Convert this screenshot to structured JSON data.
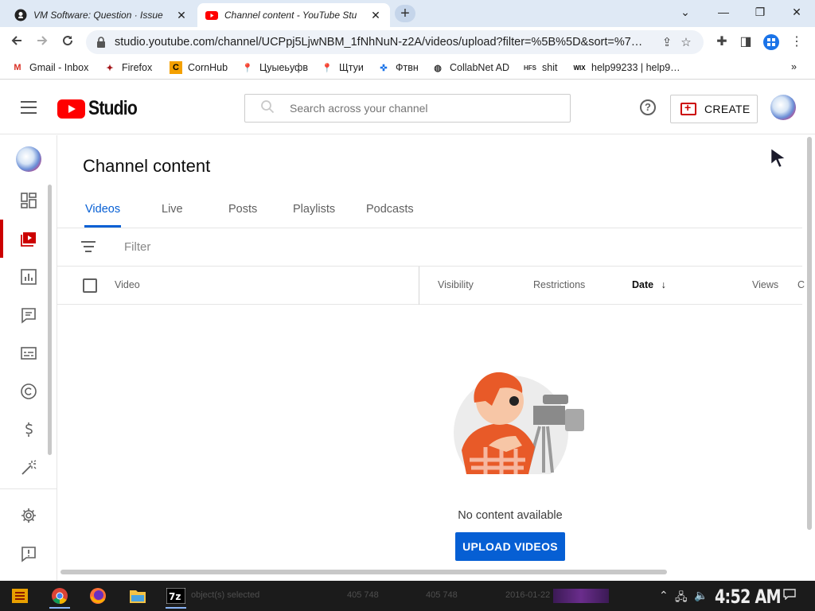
{
  "browser": {
    "tabs": [
      {
        "title": "VM Software: Question · Issue",
        "close": "✕"
      },
      {
        "title": "Channel content - YouTube Stu",
        "close": "✕"
      }
    ],
    "new_tab": "+",
    "window_controls": [
      "⌄",
      "—",
      "❐",
      "✕"
    ],
    "url": "studio.youtube.com/channel/UCPpj5LjwNBM_1fNhNuN-z2A/videos/upload?filter=%5B%5D&sort=%7…",
    "bookmarks": [
      "Gmail - Inbox",
      "Firefox",
      "CornHub",
      "Цуыеьуфв",
      "Щтуи",
      "Фтвн",
      "CollabNet AD",
      "shit",
      "help99233 | help9…"
    ],
    "bookmarks_overflow": "»"
  },
  "studio": {
    "logo_text": "Studio",
    "search_placeholder": "Search across your channel",
    "help_label": "?",
    "create_label": "CREATE"
  },
  "page": {
    "title": "Channel content",
    "tabs": [
      "Videos",
      "Live",
      "Posts",
      "Playlists",
      "Podcasts"
    ],
    "active_tab": "Videos",
    "filter_label": "Filter",
    "columns": {
      "video": "Video",
      "visibility": "Visibility",
      "restrictions": "Restrictions",
      "date": "Date",
      "date_sort": "↓",
      "views": "Views",
      "comments_partial": "C"
    },
    "empty_text": "No content available",
    "upload_button": "UPLOAD VIDEOS"
  },
  "taskbar": {
    "background_texts": [
      "object(s) selected",
      "405 748",
      "405 748",
      "2016-01-22 10:01"
    ],
    "clock": "4:52 AM",
    "tray": [
      "⌃",
      "🖧",
      "🔈"
    ]
  },
  "colors": {
    "accent_blue": "#065fd4",
    "active_red": "#cc0000",
    "youtube_red": "#ff0000"
  }
}
